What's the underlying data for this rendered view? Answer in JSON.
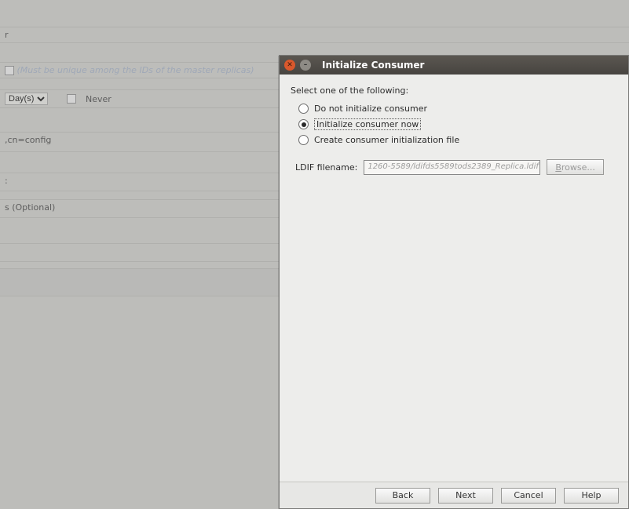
{
  "bg": {
    "header_fragment": "r",
    "unique_hint": "(Must be unique among the IDs of the master replicas)",
    "days_label": "Day(s)",
    "never_label": "Never",
    "dn_fragment": ",cn=config",
    "colon_fragment": ":",
    "optional_fragment": "s (Optional)"
  },
  "dialog": {
    "title": "Initialize Consumer",
    "prompt": "Select one of the following:",
    "options": {
      "no_init": "Do not initialize consumer",
      "init_now": "Initialize consumer now",
      "create_file": "Create consumer initialization file"
    },
    "ldif_label": "LDIF filename:",
    "ldif_value": "1260-5589/ldifds5589tods2389_Replica.ldif",
    "browse_prefix": "B",
    "browse_rest": "rowse...",
    "buttons": {
      "back": "Back",
      "next": "Next",
      "cancel": "Cancel",
      "help": "Help"
    }
  }
}
